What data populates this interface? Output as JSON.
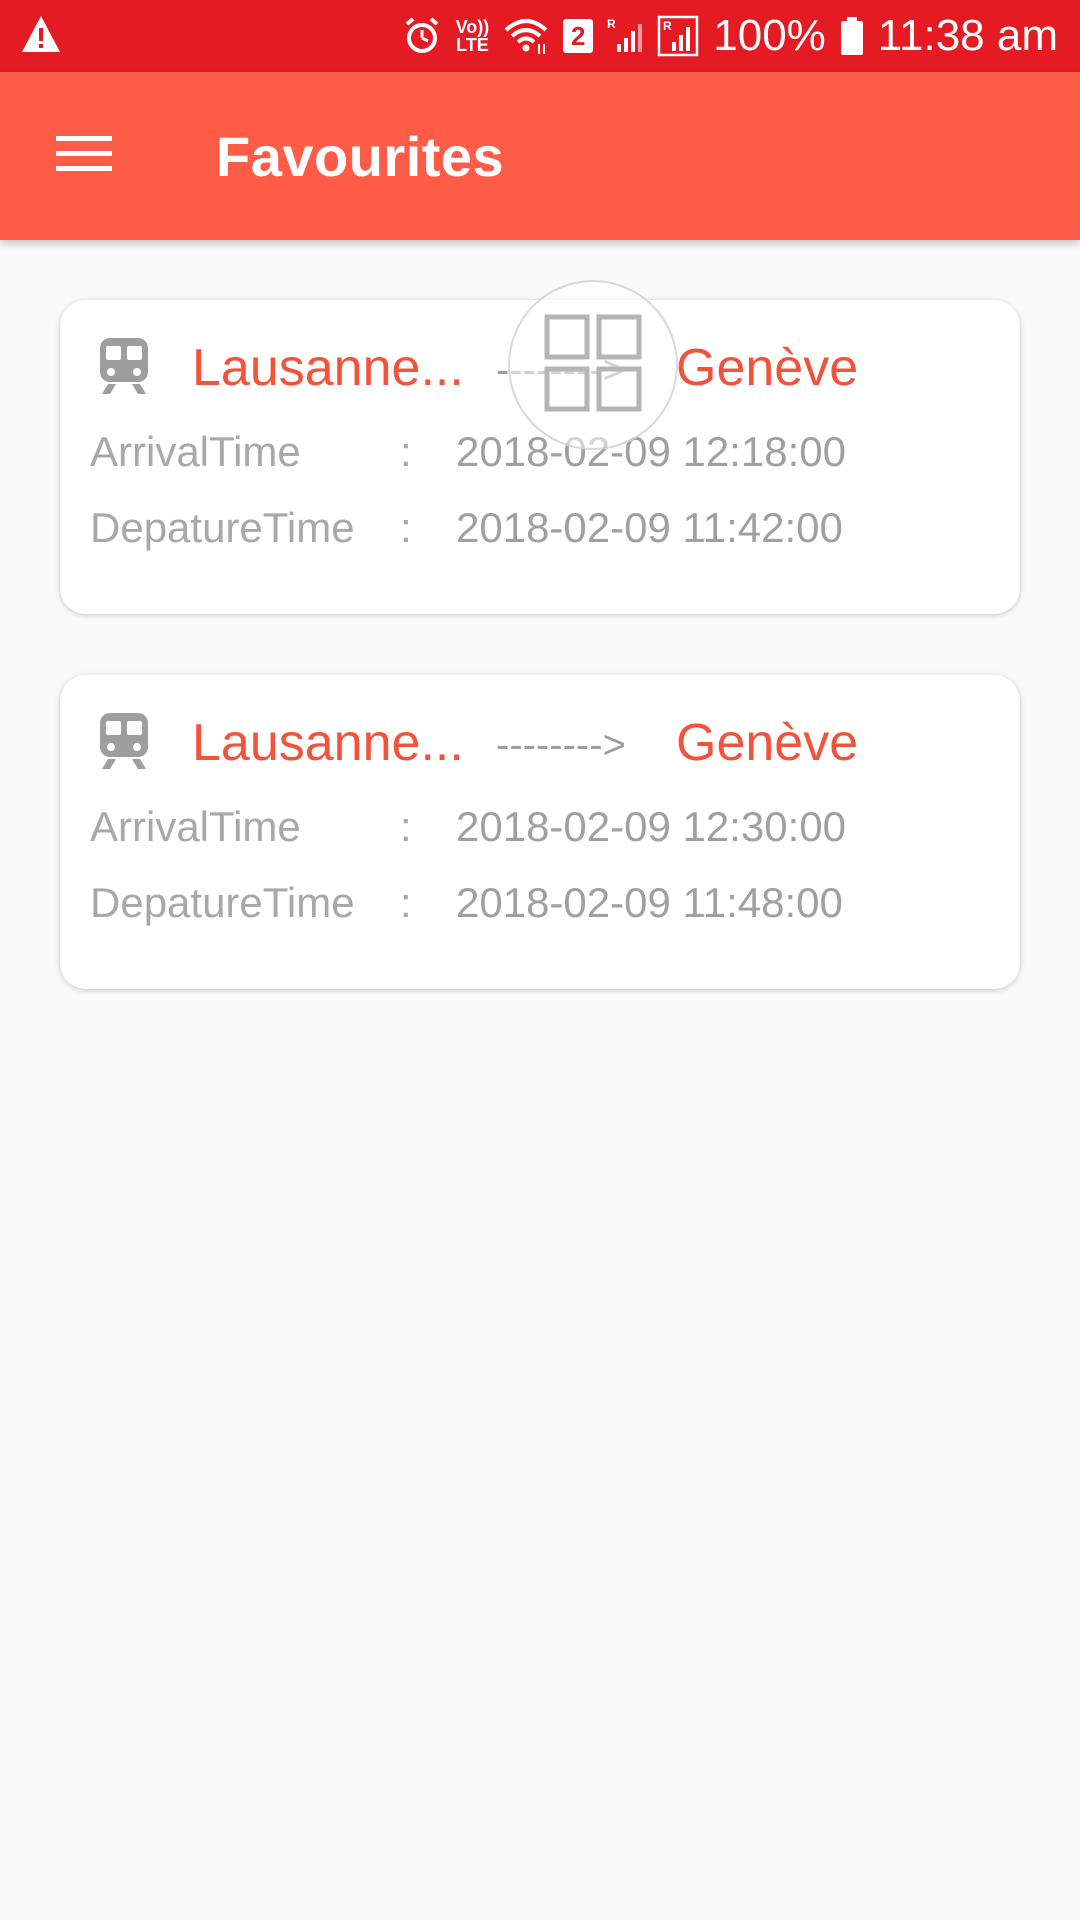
{
  "status_bar": {
    "battery": "100%",
    "time": "11:38 am",
    "sim_badge": "2",
    "volte_top": "Vo))",
    "volte_bottom": "LTE",
    "roaming": "R"
  },
  "app_bar": {
    "title": "Favourites",
    "menu_icon": "hamburger-menu-icon"
  },
  "favourites": [
    {
      "from": "Lausanne...",
      "arrow": "-------->",
      "to": "Genève",
      "arrival_label": "ArrivalTime",
      "colon": ":",
      "arrival_value": "2018-02-09 12:18:00",
      "departure_label": "DepatureTime",
      "departure_value": "2018-02-09 11:42:00"
    },
    {
      "from": "Lausanne...",
      "arrow": "-------->",
      "to": "Genève",
      "arrival_label": "ArrivalTime",
      "colon": ":",
      "arrival_value": "2018-02-09 12:30:00",
      "departure_label": "DepatureTime",
      "departure_value": "2018-02-09 11:48:00"
    }
  ],
  "colors": {
    "status_bar": "#e51b24",
    "app_bar": "#ff5c47",
    "accent_text": "#f4533b",
    "secondary_text": "#a8a8a8",
    "background": "#fafafa"
  }
}
